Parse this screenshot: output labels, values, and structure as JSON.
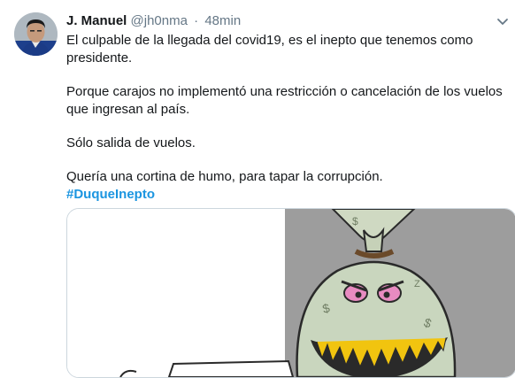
{
  "tweet": {
    "author_name": "J. Manuel",
    "handle": "@jh0nma",
    "separator": "·",
    "time": "48min",
    "paragraphs": [
      "El culpable de la llegada del covid19, es el inepto que tenemos como presidente.",
      "Porque carajos no implementó una restricción o cancelación de los vuelos que ingresan al país.",
      "Sólo salida de vuelos.",
      "Quería una cortina de humo, para tapar la corrupción."
    ],
    "hashtag": "#DuqueInepto"
  },
  "icons": {
    "menu": "chevron-down-icon",
    "avatar": "user-avatar"
  },
  "colors": {
    "hashtag": "#1b95e0",
    "muted": "#657786",
    "text": "#14171a"
  }
}
